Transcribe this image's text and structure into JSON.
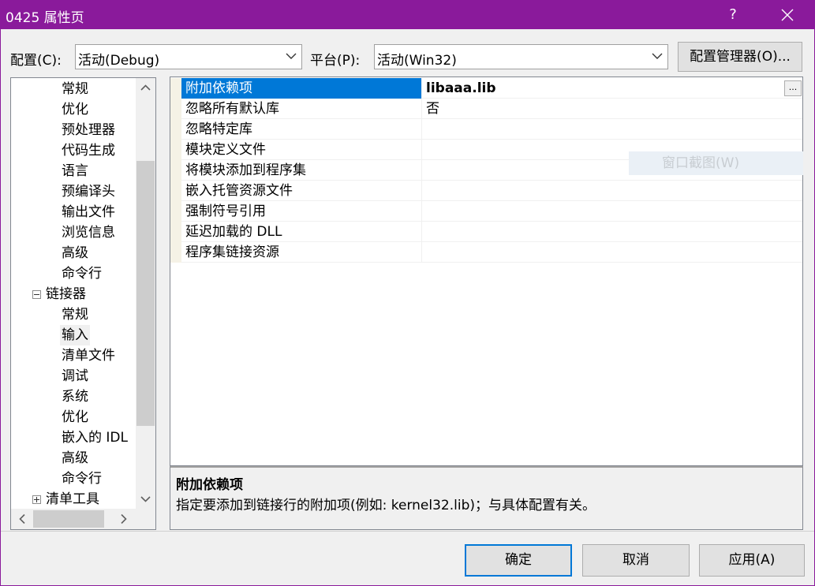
{
  "window": {
    "title": "0425 属性页",
    "help_glyph": "?"
  },
  "toolbar": {
    "config_label": "配置(C):",
    "config_value": "活动(Debug)",
    "platform_label": "平台(P):",
    "platform_value": "活动(Win32)",
    "config_manager_label": "配置管理器(O)..."
  },
  "tree": {
    "items": [
      {
        "label": "常规",
        "level": 2
      },
      {
        "label": "优化",
        "level": 2
      },
      {
        "label": "预处理器",
        "level": 2
      },
      {
        "label": "代码生成",
        "level": 2
      },
      {
        "label": "语言",
        "level": 2
      },
      {
        "label": "预编译头",
        "level": 2
      },
      {
        "label": "输出文件",
        "level": 2
      },
      {
        "label": "浏览信息",
        "level": 2
      },
      {
        "label": "高级",
        "level": 2
      },
      {
        "label": "命令行",
        "level": 2
      },
      {
        "label": "链接器",
        "level": 1,
        "expander": "minus"
      },
      {
        "label": "常规",
        "level": 2
      },
      {
        "label": "输入",
        "level": 2,
        "selected": true
      },
      {
        "label": "清单文件",
        "level": 2
      },
      {
        "label": "调试",
        "level": 2
      },
      {
        "label": "系统",
        "level": 2
      },
      {
        "label": "优化",
        "level": 2
      },
      {
        "label": "嵌入的 IDL",
        "level": 2
      },
      {
        "label": "高级",
        "level": 2
      },
      {
        "label": "命令行",
        "level": 2
      },
      {
        "label": "清单工具",
        "level": 1,
        "expander": "plus"
      }
    ]
  },
  "properties": {
    "rows": [
      {
        "name": "附加依赖项",
        "value": "libaaa.lib",
        "selected": true
      },
      {
        "name": "忽略所有默认库",
        "value": "否"
      },
      {
        "name": "忽略特定库",
        "value": ""
      },
      {
        "name": "模块定义文件",
        "value": ""
      },
      {
        "name": "将模块添加到程序集",
        "value": ""
      },
      {
        "name": "嵌入托管资源文件",
        "value": ""
      },
      {
        "name": "强制符号引用",
        "value": ""
      },
      {
        "name": "延迟加载的 DLL",
        "value": ""
      },
      {
        "name": "程序集链接资源",
        "value": ""
      }
    ],
    "ellipsis_label": "..."
  },
  "overlay": {
    "window_capture_label": "窗口截图(W)"
  },
  "description": {
    "title": "附加依赖项",
    "text": "指定要添加到链接行的附加项(例如: kernel32.lib)；与具体配置有关。"
  },
  "buttons": {
    "ok": "确定",
    "cancel": "取消",
    "apply": "应用(A)"
  },
  "colors": {
    "titlebar": "#8a1a9b",
    "selection": "#0078d7",
    "default_button_border": "#0078d7"
  }
}
